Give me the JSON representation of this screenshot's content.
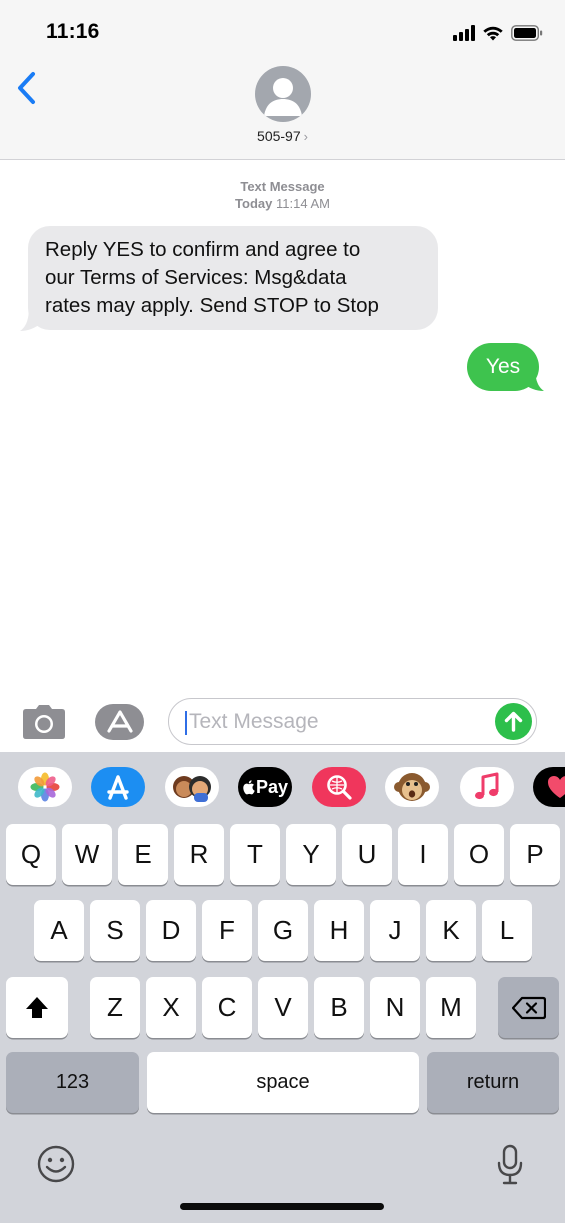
{
  "status_bar": {
    "time": "11:16",
    "icons": [
      "cellular-signal-icon",
      "wifi-icon",
      "battery-icon"
    ]
  },
  "header": {
    "back_icon": "chevron-left-icon",
    "contact_name": "505-97",
    "contact_chevron": "›"
  },
  "conversation": {
    "service_label": "Text Message",
    "day_label": "Today",
    "time_label": "11:14 AM",
    "incoming_message": {
      "lines": [
        "Reply YES to confirm and agree to",
        "our Terms of Services: Msg&data",
        "rates may apply. Send STOP to Stop"
      ]
    },
    "outgoing_message": {
      "text": "Yes"
    }
  },
  "input_bar": {
    "placeholder": "Text Message",
    "buttons": [
      "camera-icon",
      "app-store-icon",
      "send-arrow-icon"
    ]
  },
  "app_drawer": {
    "apps": [
      "photos-icon",
      "app-store-icon",
      "memoji-stickers-icon",
      "apple-pay-icon",
      "web-images-search-icon",
      "monkey-animoji-icon",
      "music-icon",
      "digital-touch-icon"
    ],
    "apple_pay_label": "Pay"
  },
  "keyboard": {
    "row1": [
      "Q",
      "W",
      "E",
      "R",
      "T",
      "Y",
      "U",
      "I",
      "O",
      "P"
    ],
    "row2": [
      "A",
      "S",
      "D",
      "F",
      "G",
      "H",
      "J",
      "K",
      "L"
    ],
    "row3": [
      "Z",
      "X",
      "C",
      "V",
      "B",
      "N",
      "M"
    ],
    "numbers_label": "123",
    "space_label": "space",
    "return_label": "return"
  },
  "colors": {
    "accent_blue": "#1a7cf5",
    "sent_bubble": "#3ec34e",
    "received_bubble": "#e9e9eb",
    "keyboard_bg": "#d2d4da"
  }
}
